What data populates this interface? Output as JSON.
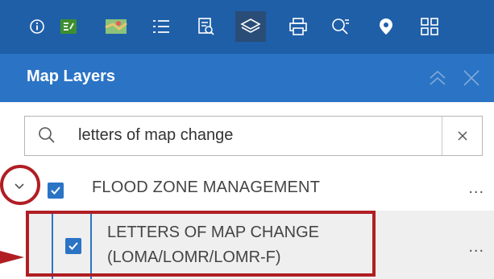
{
  "toolbar": {
    "icons": [
      "info-icon",
      "legend-icon",
      "basemap-icon",
      "list-icon",
      "query-icon",
      "layers-icon",
      "print-icon",
      "search-icon",
      "location-pin-icon",
      "grid-icon"
    ],
    "active": "layers-icon",
    "background": "#1f5fa8"
  },
  "panel": {
    "title": "Map Layers",
    "background": "#2b74c5"
  },
  "search": {
    "value": "letters of map change"
  },
  "group": {
    "label": "FLOOD ZONE MANAGEMENT",
    "checked": true,
    "more": "..."
  },
  "layer": {
    "line1": "LETTERS OF MAP CHANGE",
    "line2": "(LOMA/LOMR/LOMR-F)",
    "checked": true,
    "more": "..."
  },
  "colors": {
    "accent": "#2b74c5",
    "callout": "#b01e23"
  }
}
